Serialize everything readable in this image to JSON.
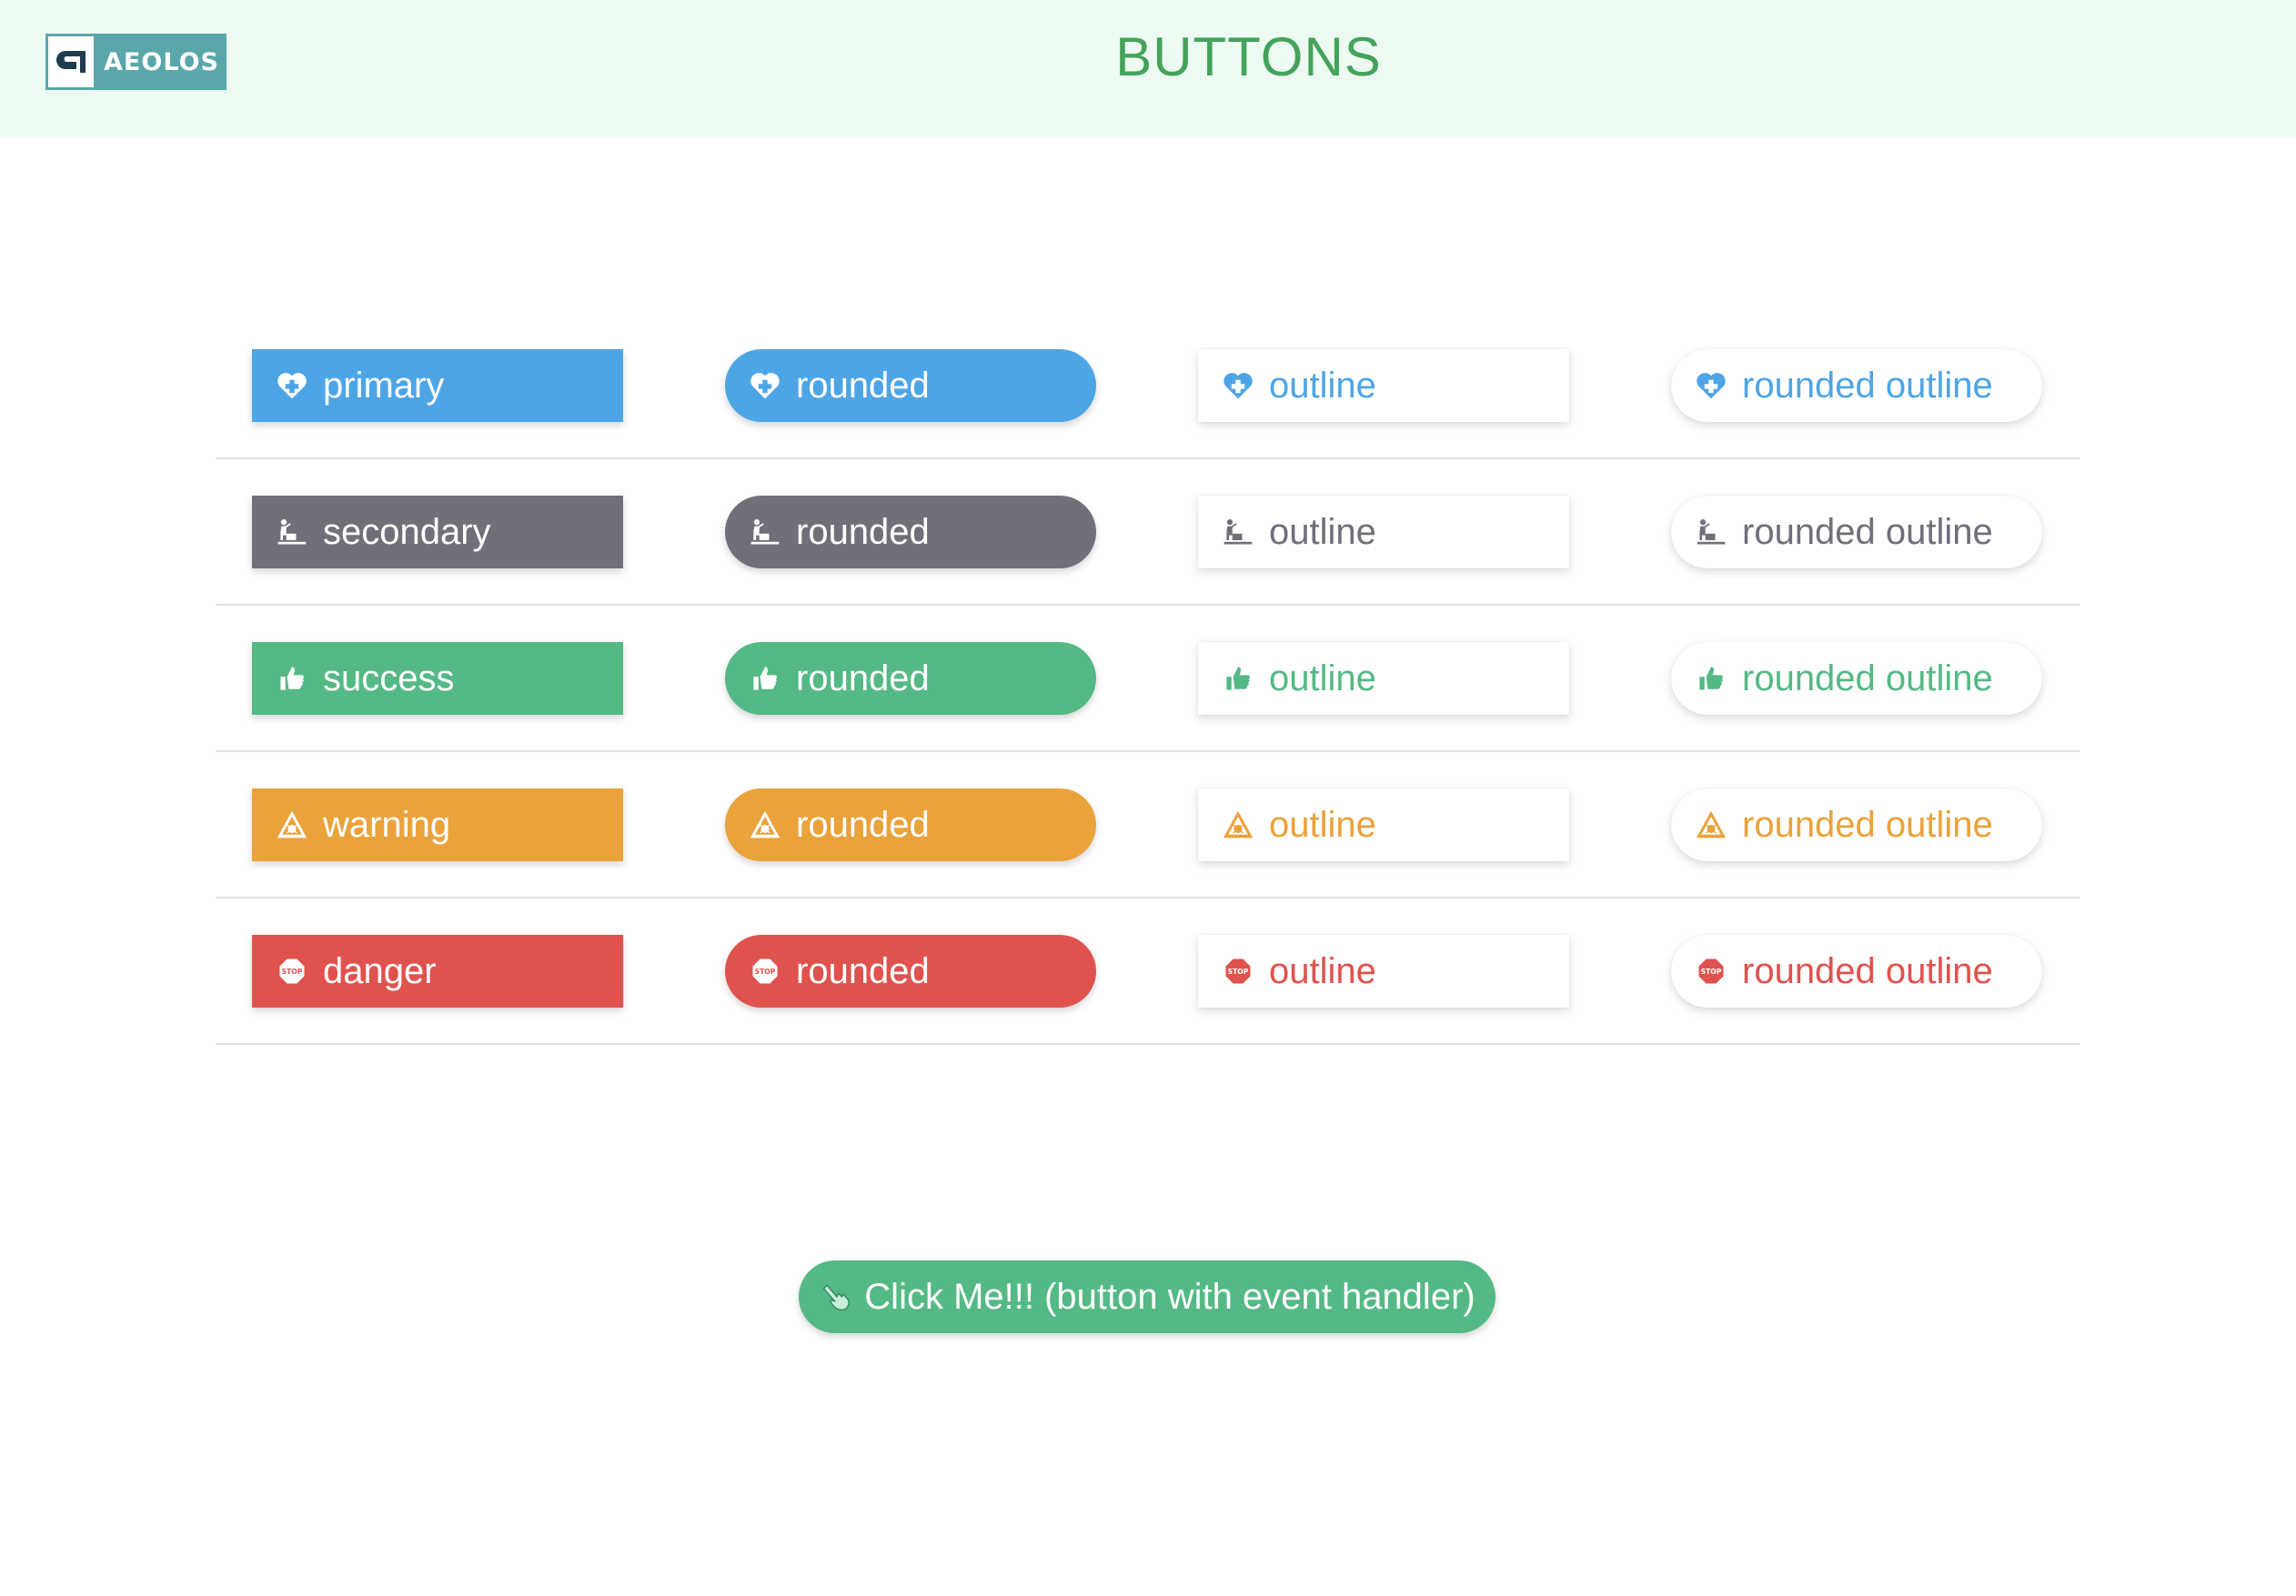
{
  "header": {
    "logo_text": "AEOLOS",
    "title": "BUTTONS"
  },
  "colors": {
    "primary": "#4ea5e6",
    "secondary": "#6f7078",
    "success": "#54b985",
    "warning": "#eaa23a",
    "danger": "#e0524e",
    "header_bg": "#edfaf2",
    "title": "#43a35a"
  },
  "rows": [
    {
      "variant": "primary",
      "icon": "heart-plus-icon",
      "labels": [
        "primary",
        "rounded",
        "outline",
        "rounded outline"
      ]
    },
    {
      "variant": "secondary",
      "icon": "desk-worker-icon",
      "labels": [
        "secondary",
        "rounded",
        "outline",
        "rounded outline"
      ]
    },
    {
      "variant": "success",
      "icon": "thumbs-up-icon",
      "labels": [
        "success",
        "rounded",
        "outline",
        "rounded outline"
      ]
    },
    {
      "variant": "warning",
      "icon": "warning-triangle-icon",
      "labels": [
        "warning",
        "rounded",
        "outline",
        "rounded outline"
      ]
    },
    {
      "variant": "danger",
      "icon": "stop-sign-icon",
      "labels": [
        "danger",
        "rounded",
        "outline",
        "rounded outline"
      ]
    }
  ],
  "cta": {
    "icon": "pointing-hand-icon",
    "label": "Click Me!!! (button with event handler)"
  }
}
